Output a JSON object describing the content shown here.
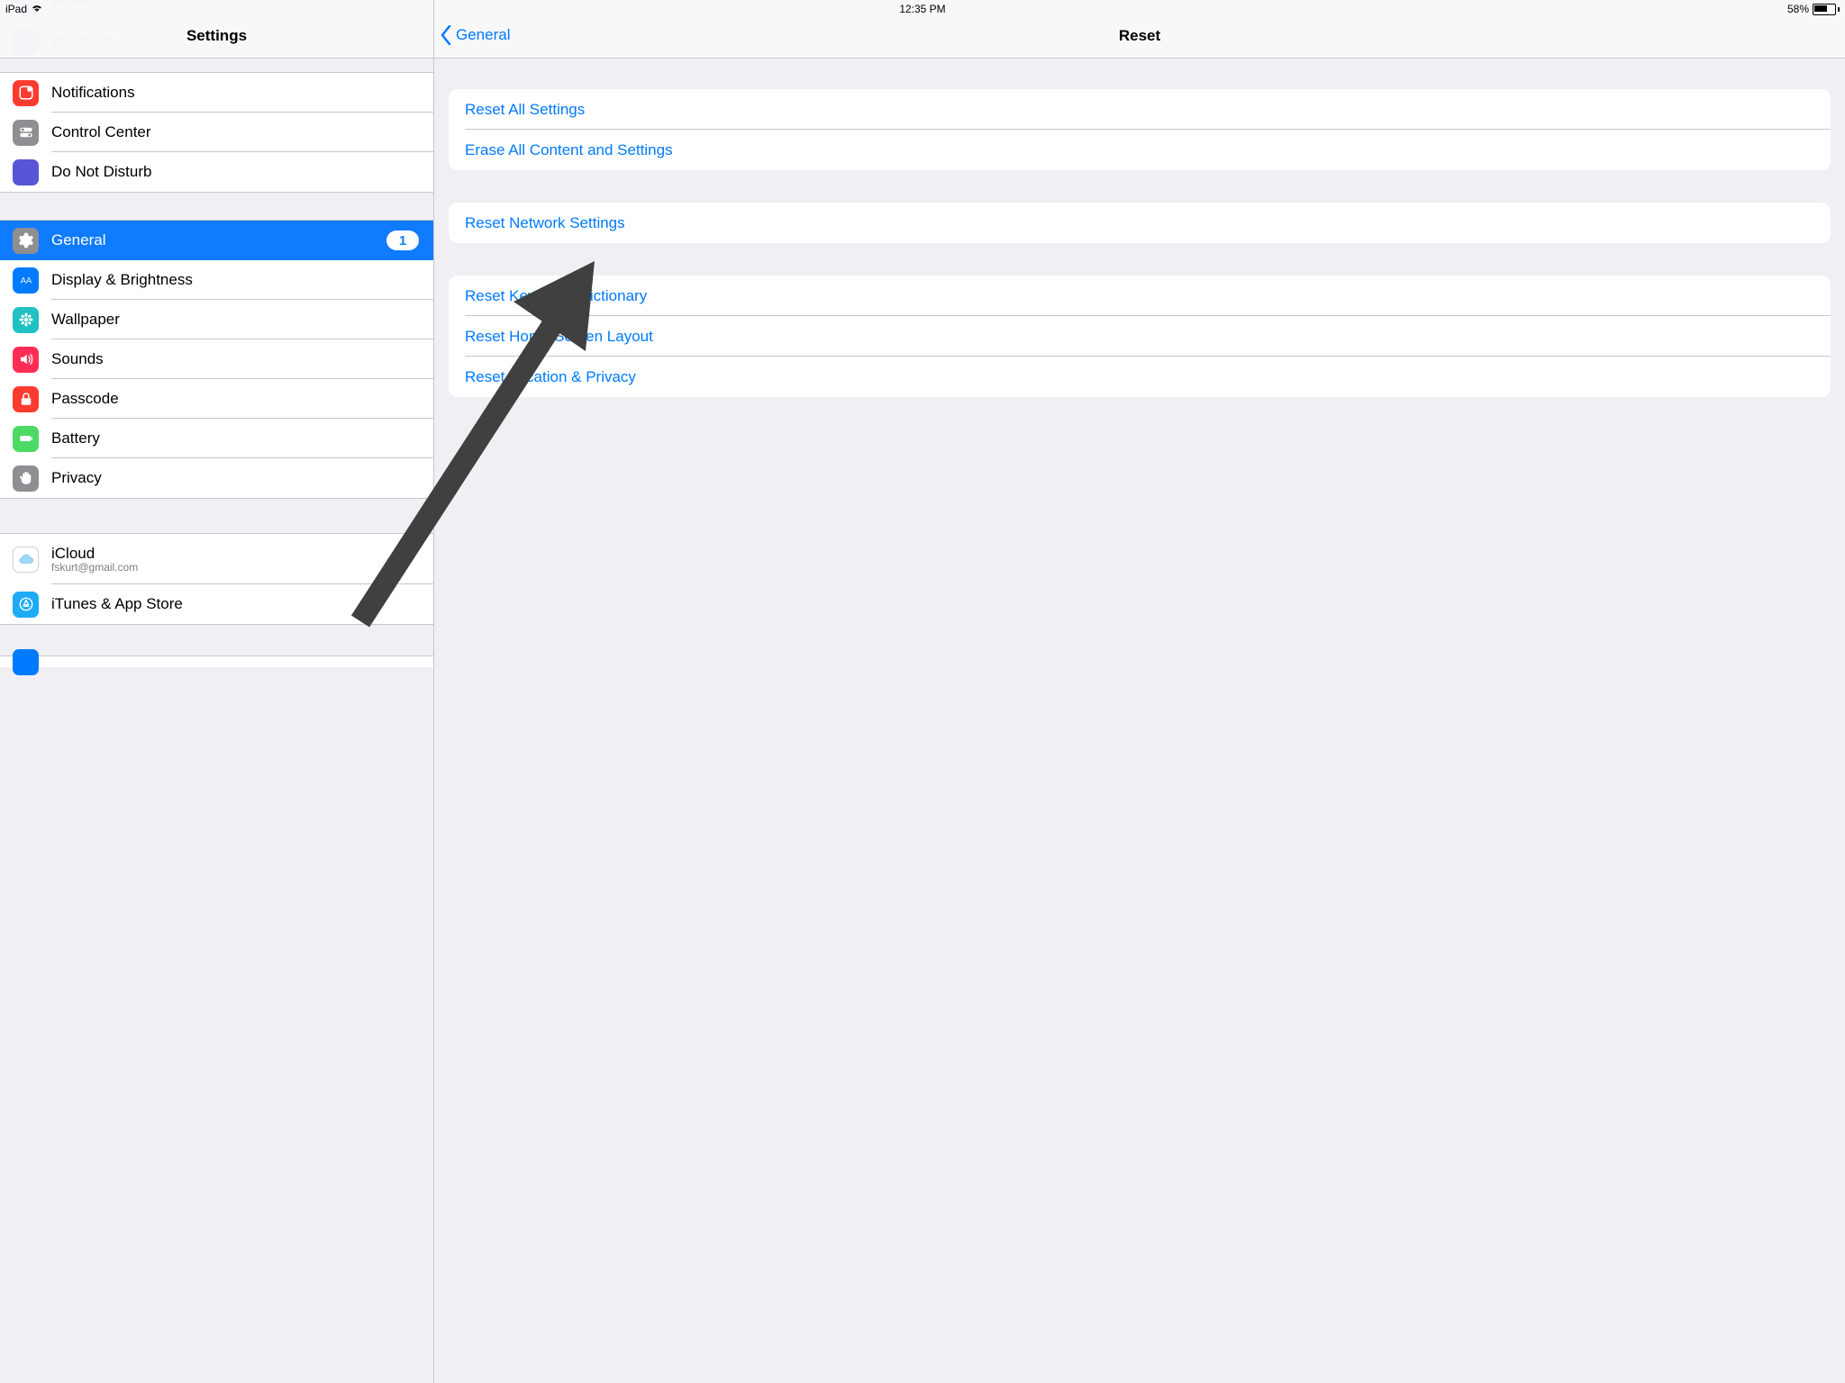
{
  "status_bar": {
    "device": "iPad",
    "time": "12:35 PM",
    "battery_pct": "58%"
  },
  "sidebar": {
    "title": "Settings",
    "ghost_wifi": {
      "label": "Wi-Fi",
      "value": "superhero"
    },
    "ghost_bt": {
      "label": "Bluetooth",
      "value": "Off"
    },
    "groups": [
      [
        {
          "id": "notifications",
          "label": "Notifications",
          "icon_bg": "#ff3b30",
          "icon": "notifications"
        },
        {
          "id": "control-center",
          "label": "Control Center",
          "icon_bg": "#8e8e93",
          "icon": "toggles"
        },
        {
          "id": "dnd",
          "label": "Do Not Disturb",
          "icon_bg": "#5856d6",
          "icon": "moon"
        }
      ],
      [
        {
          "id": "general",
          "label": "General",
          "icon_bg": "#8e8e93",
          "icon": "gear",
          "selected": true,
          "badge": "1"
        },
        {
          "id": "display",
          "label": "Display & Brightness",
          "icon_bg": "#007aff",
          "icon": "aa"
        },
        {
          "id": "wallpaper",
          "label": "Wallpaper",
          "icon_bg": "#1fc1c3",
          "icon": "flower"
        },
        {
          "id": "sounds",
          "label": "Sounds",
          "icon_bg": "#ff2d55",
          "icon": "speaker"
        },
        {
          "id": "passcode",
          "label": "Passcode",
          "icon_bg": "#ff3b30",
          "icon": "lock"
        },
        {
          "id": "battery",
          "label": "Battery",
          "icon_bg": "#4cd964",
          "icon": "battery"
        },
        {
          "id": "privacy",
          "label": "Privacy",
          "icon_bg": "#8e8e93",
          "icon": "hand"
        }
      ],
      [
        {
          "id": "icloud",
          "label": "iCloud",
          "sublabel": "fskurt@gmail.com",
          "icon_bg": "#ffffff",
          "icon": "cloud"
        },
        {
          "id": "itunes",
          "label": "iTunes & App Store",
          "icon_bg": "#1dabf8",
          "icon": "appstore"
        }
      ]
    ]
  },
  "detail": {
    "back_label": "General",
    "title": "Reset",
    "groups": [
      [
        {
          "id": "reset-all",
          "label": "Reset All Settings"
        },
        {
          "id": "erase-all",
          "label": "Erase All Content and Settings"
        }
      ],
      [
        {
          "id": "reset-network",
          "label": "Reset Network Settings"
        }
      ],
      [
        {
          "id": "reset-keyboard",
          "label": "Reset Keyboard Dictionary"
        },
        {
          "id": "reset-home",
          "label": "Reset Home Screen Layout"
        },
        {
          "id": "reset-location",
          "label": "Reset Location & Privacy"
        }
      ]
    ]
  }
}
